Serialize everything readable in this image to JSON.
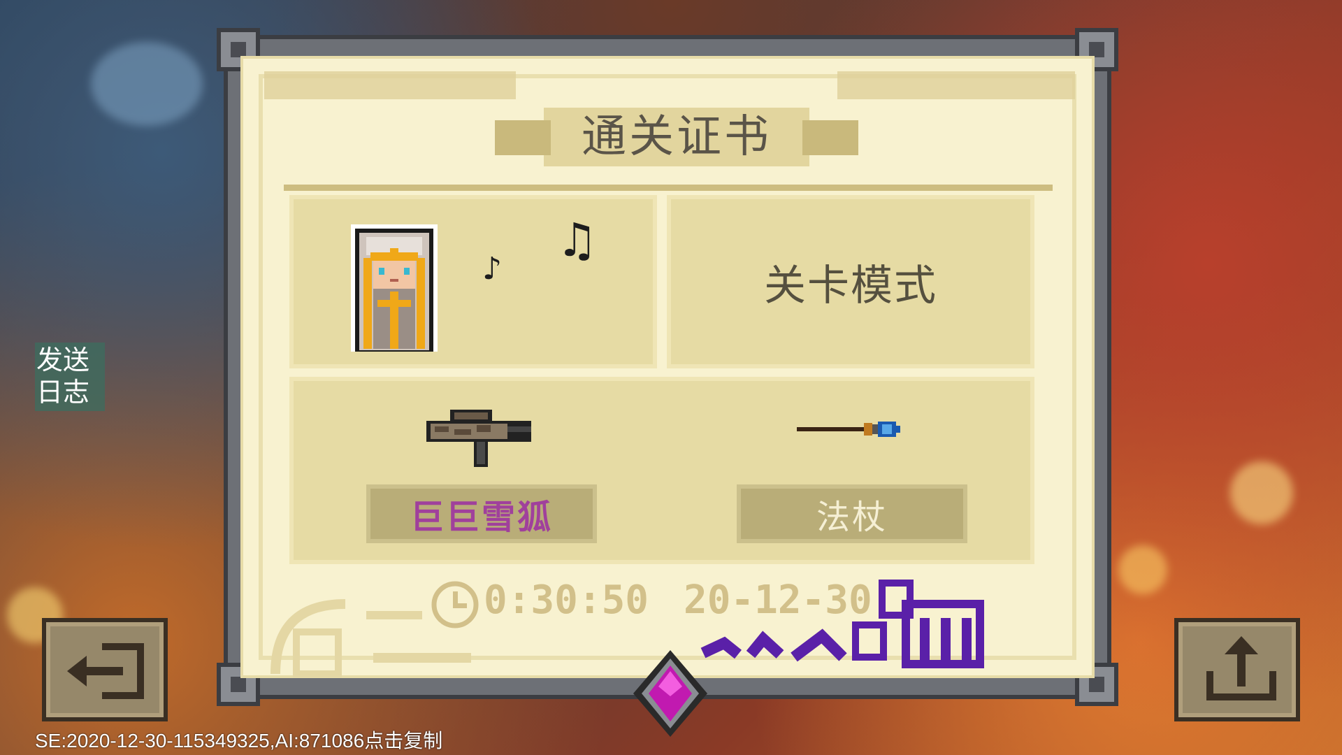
{
  "certificate": {
    "title": "通关证书",
    "mode": "关卡模式",
    "weapons": [
      {
        "name": "巨巨雪狐",
        "icon": "rifle-icon",
        "color": "#a0409c"
      },
      {
        "name": "法杖",
        "icon": "staff-icon",
        "color": "#f5efd4"
      }
    ],
    "time": "0:30:50",
    "date": "20-12-30"
  },
  "sidebar": {
    "log_line1": "发送",
    "log_line2": "日志"
  },
  "footer": {
    "session_text": "SE:2020-12-30-115349325,AI:871086点击复制"
  },
  "icons": {
    "exit": "exit-icon",
    "share": "share-icon",
    "clock": "clock-icon",
    "gem": "gem-icon",
    "notes": "music-note-icon"
  }
}
